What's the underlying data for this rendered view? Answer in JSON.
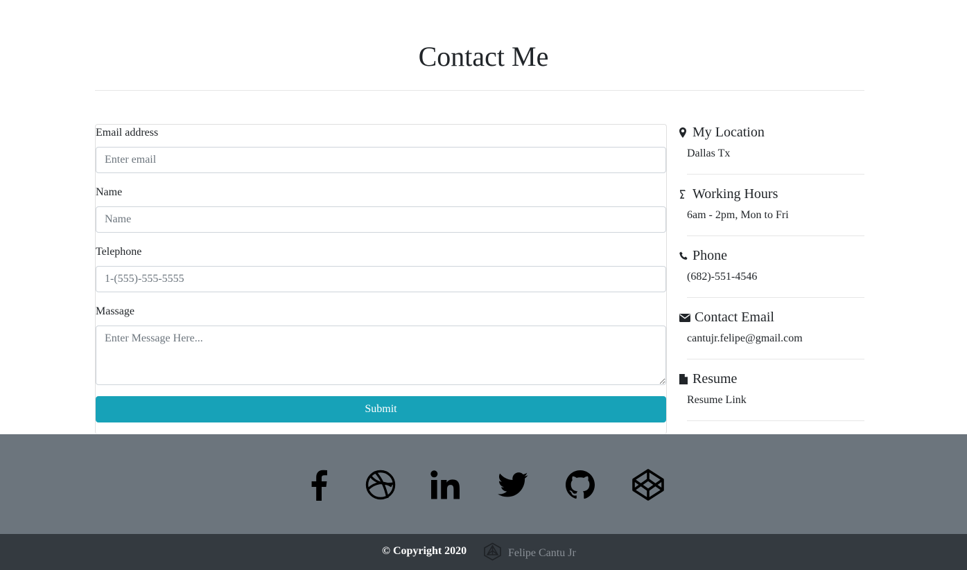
{
  "header": {
    "title": "Contact Me"
  },
  "form": {
    "email": {
      "label": "Email address",
      "placeholder": "Enter email",
      "value": ""
    },
    "name": {
      "label": "Name",
      "placeholder": "Name",
      "value": ""
    },
    "telephone": {
      "label": "Telephone",
      "placeholder": "1-(555)-555-5555",
      "value": ""
    },
    "message": {
      "label": "Massage",
      "placeholder": "Enter Message Here...",
      "value": ""
    },
    "submit_label": "Submit"
  },
  "info": {
    "location": {
      "icon": "map-marker-icon",
      "title": "My Location",
      "value": "Dallas Tx"
    },
    "hours": {
      "icon": "hourglass-icon",
      "title": "Working Hours",
      "value": "6am - 2pm, Mon to Fri"
    },
    "phone": {
      "icon": "phone-icon",
      "title": "Phone",
      "value": "(682)-551-4546"
    },
    "email": {
      "icon": "envelope-icon",
      "title": "Contact Email",
      "value": "cantujr.felipe@gmail.com"
    },
    "resume": {
      "icon": "file-icon",
      "title": "Resume",
      "value": "Resume Link"
    }
  },
  "social": [
    {
      "name": "facebook-icon"
    },
    {
      "name": "dribbble-icon"
    },
    {
      "name": "linkedin-icon"
    },
    {
      "name": "twitter-icon"
    },
    {
      "name": "github-icon"
    },
    {
      "name": "codepen-icon"
    }
  ],
  "footer": {
    "copyright": "© Copyright 2020",
    "brand_name": "Felipe Cantu Jr"
  },
  "colors": {
    "accent": "#17a2b8",
    "social_band": "#6c757d",
    "footer_bg": "#343a40"
  }
}
